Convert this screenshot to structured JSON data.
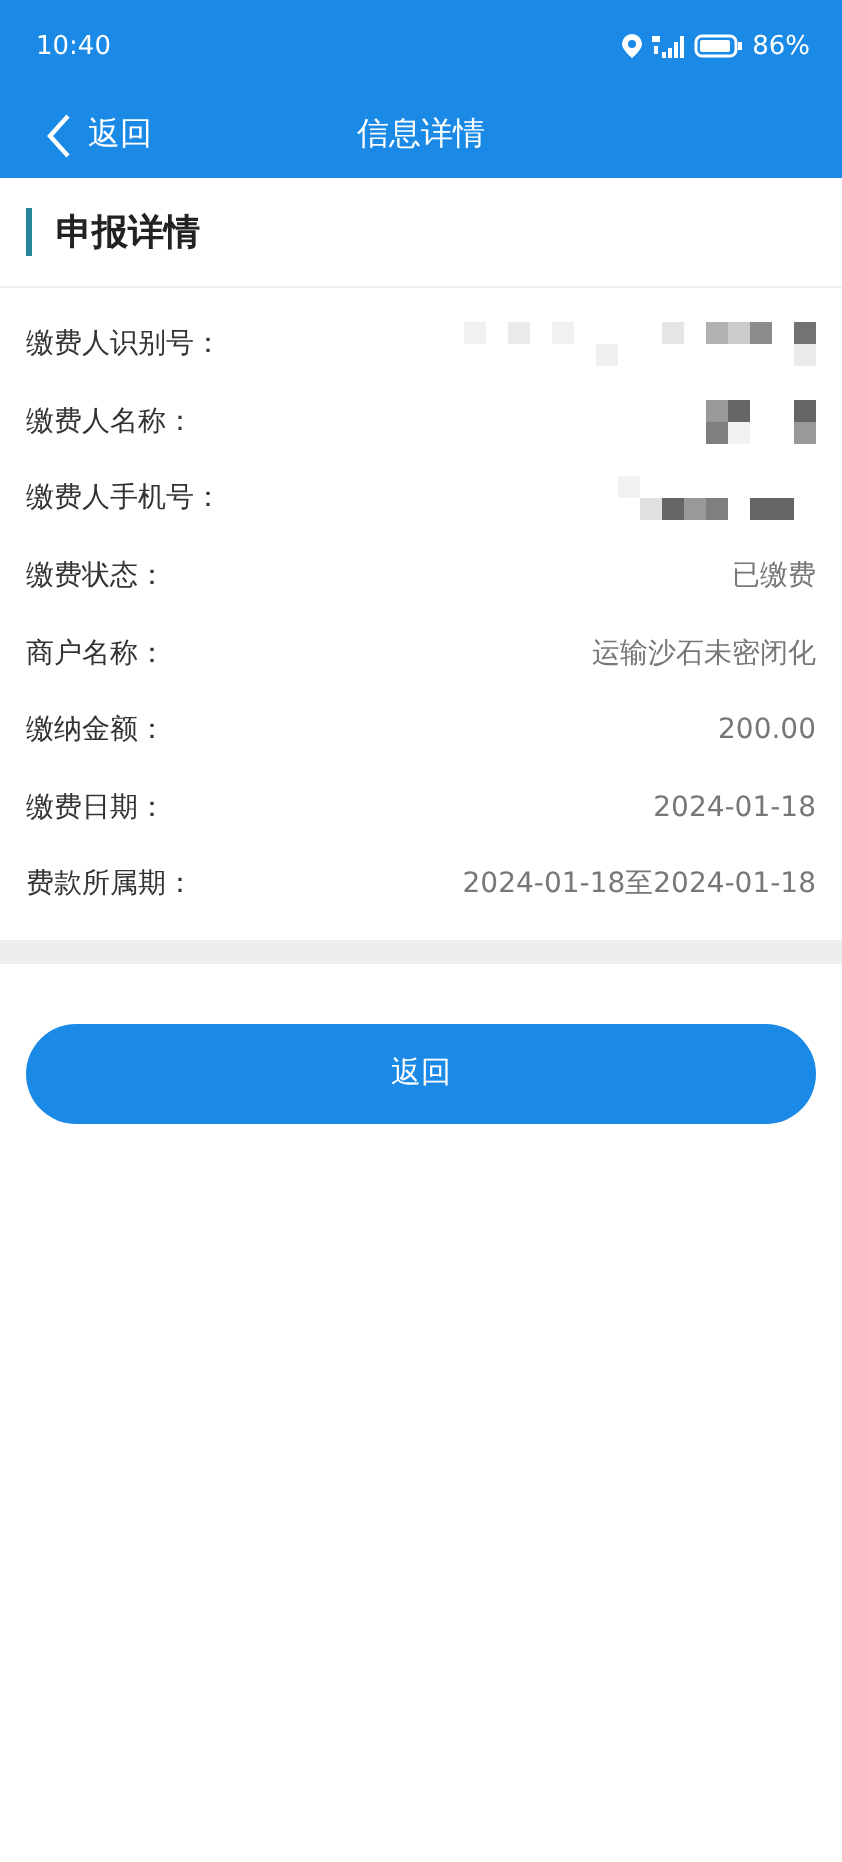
{
  "status_bar": {
    "time": "10:40",
    "battery": "86%"
  },
  "nav": {
    "back": "返回",
    "title": "信息详情"
  },
  "section": {
    "title": "申报详情"
  },
  "rows": [
    {
      "label": "缴费人识别号：",
      "kind": "redacted"
    },
    {
      "label": "缴费人名称：",
      "kind": "redacted"
    },
    {
      "label": "缴费人手机号：",
      "kind": "redacted"
    },
    {
      "label": "缴费状态：",
      "kind": "text",
      "value": "已缴费"
    },
    {
      "label": "商户名称：",
      "kind": "text",
      "value": "运输沙石未密闭化"
    },
    {
      "label": "缴纳金额：",
      "kind": "text",
      "value": "200.00"
    },
    {
      "label": "缴费日期：",
      "kind": "text",
      "value": "2024-01-18"
    },
    {
      "label": "费款所属期：",
      "kind": "text",
      "value": "2024-01-18至2024-01-18"
    }
  ],
  "button": "返回"
}
